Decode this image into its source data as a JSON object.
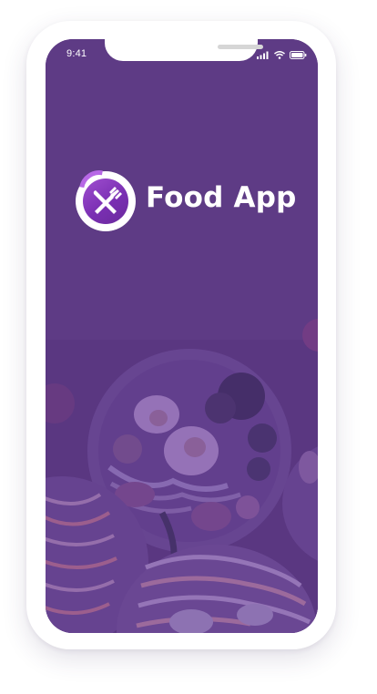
{
  "status_bar": {
    "time": "9:41",
    "icons": [
      "signal-icon",
      "wifi-icon",
      "battery-icon"
    ]
  },
  "splash": {
    "app_name": "Food App",
    "logo_icon": "fork-knife-icon",
    "background_image": "food-bowls-photo"
  },
  "colors": {
    "overlay": "#5c3a82",
    "logo_gradient_start": "#a04fd0",
    "logo_gradient_end": "#6a2a9c",
    "text": "#ffffff"
  }
}
